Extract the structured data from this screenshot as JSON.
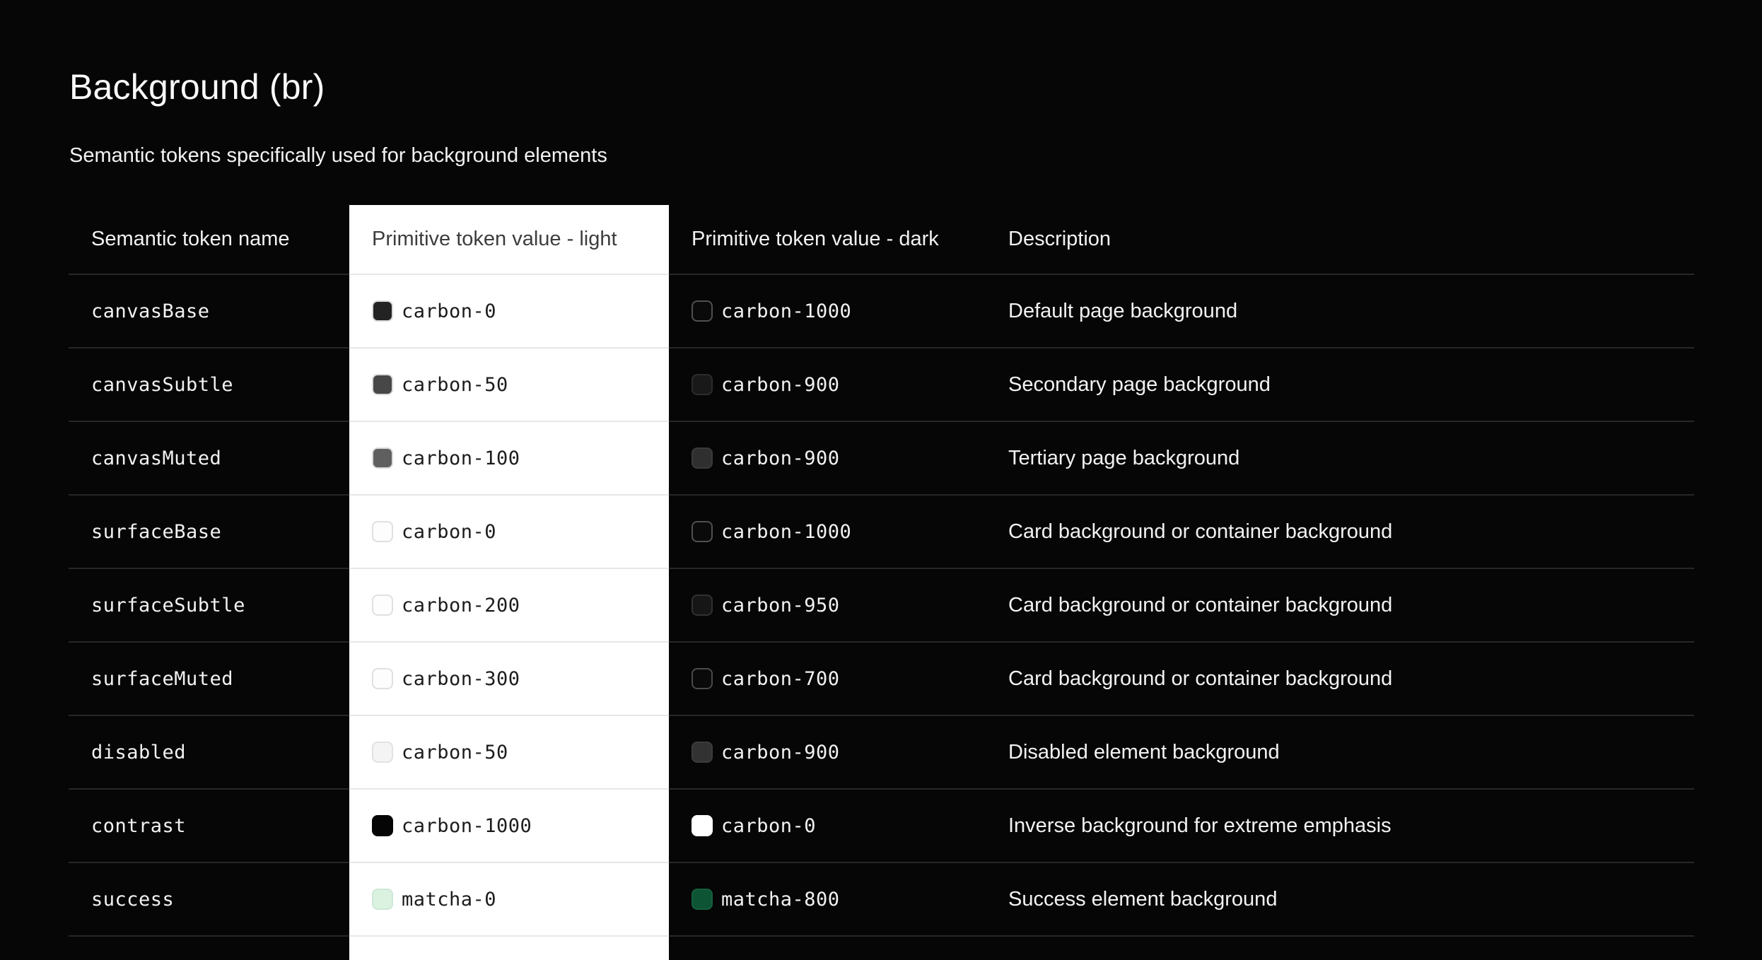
{
  "page": {
    "title": "Background (br)",
    "subtitle": "Semantic tokens specifically used for background elements"
  },
  "colors": {
    "page_background": "#060606",
    "light_column_background": "#ffffff",
    "divider_on_dark": "#272727",
    "divider_on_light": "#e7e7e7",
    "success_light_swatch": "#dcf2e1",
    "success_dark_swatch": "#0d5434"
  },
  "table": {
    "columns": [
      "Semantic token name",
      "Primitive token value - light",
      "Primitive token value - dark",
      "Description"
    ],
    "rows": [
      {
        "name": "canvasBase",
        "light": {
          "token": "carbon-0",
          "swatch": "#232323",
          "swatch_border": "#d9d9d9"
        },
        "dark": {
          "token": "carbon-1000",
          "swatch": "#0a0a0a",
          "swatch_border": "#505050"
        },
        "description": "Default page background"
      },
      {
        "name": "canvasSubtle",
        "light": {
          "token": "carbon-50",
          "swatch": "#474747",
          "swatch_border": "#d9d9d9"
        },
        "dark": {
          "token": "carbon-900",
          "swatch": "#191919",
          "swatch_border": "#2c2c2c"
        },
        "description": "Secondary page background"
      },
      {
        "name": "canvasMuted",
        "light": {
          "token": "carbon-100",
          "swatch": "#5f5f5f",
          "swatch_border": "#d9d9d9"
        },
        "dark": {
          "token": "carbon-900",
          "swatch": "#2f2f2f",
          "swatch_border": "#3a3a3a"
        },
        "description": "Tertiary page background"
      },
      {
        "name": "surfaceBase",
        "light": {
          "token": "carbon-0",
          "swatch": "#fdfdfd",
          "swatch_border": "#e0e0e0"
        },
        "dark": {
          "token": "carbon-1000",
          "swatch": "#0a0a0a",
          "swatch_border": "#505050"
        },
        "description": "Card background or container background"
      },
      {
        "name": "surfaceSubtle",
        "light": {
          "token": "carbon-200",
          "swatch": "#fdfdfd",
          "swatch_border": "#e0e0e0"
        },
        "dark": {
          "token": "carbon-950",
          "swatch": "#161616",
          "swatch_border": "#313131"
        },
        "description": "Card background or container background"
      },
      {
        "name": "surfaceMuted",
        "light": {
          "token": "carbon-300",
          "swatch": "#fdfdfd",
          "swatch_border": "#e0e0e0"
        },
        "dark": {
          "token": "carbon-700",
          "swatch": "#0a0a0a",
          "swatch_border": "#4a4a4a"
        },
        "description": "Card background or container background"
      },
      {
        "name": "disabled",
        "light": {
          "token": "carbon-50",
          "swatch": "#f4f4f4",
          "swatch_border": "#e2e2e2"
        },
        "dark": {
          "token": "carbon-900",
          "swatch": "#323232",
          "swatch_border": "#3c3c3c"
        },
        "description": "Disabled element background"
      },
      {
        "name": "contrast",
        "light": {
          "token": "carbon-1000",
          "swatch": "#050505",
          "swatch_border": "#050505"
        },
        "dark": {
          "token": "carbon-0",
          "swatch": "#ffffff",
          "swatch_border": "#ffffff"
        },
        "description": "Inverse background for extreme emphasis"
      },
      {
        "name": "success",
        "light": {
          "token": "matcha-0",
          "swatch": "#dcf2e1",
          "swatch_border": "#cde8d6"
        },
        "dark": {
          "token": "matcha-800",
          "swatch": "#0d5434",
          "swatch_border": "#15603e"
        },
        "description": "Success element background"
      }
    ]
  }
}
